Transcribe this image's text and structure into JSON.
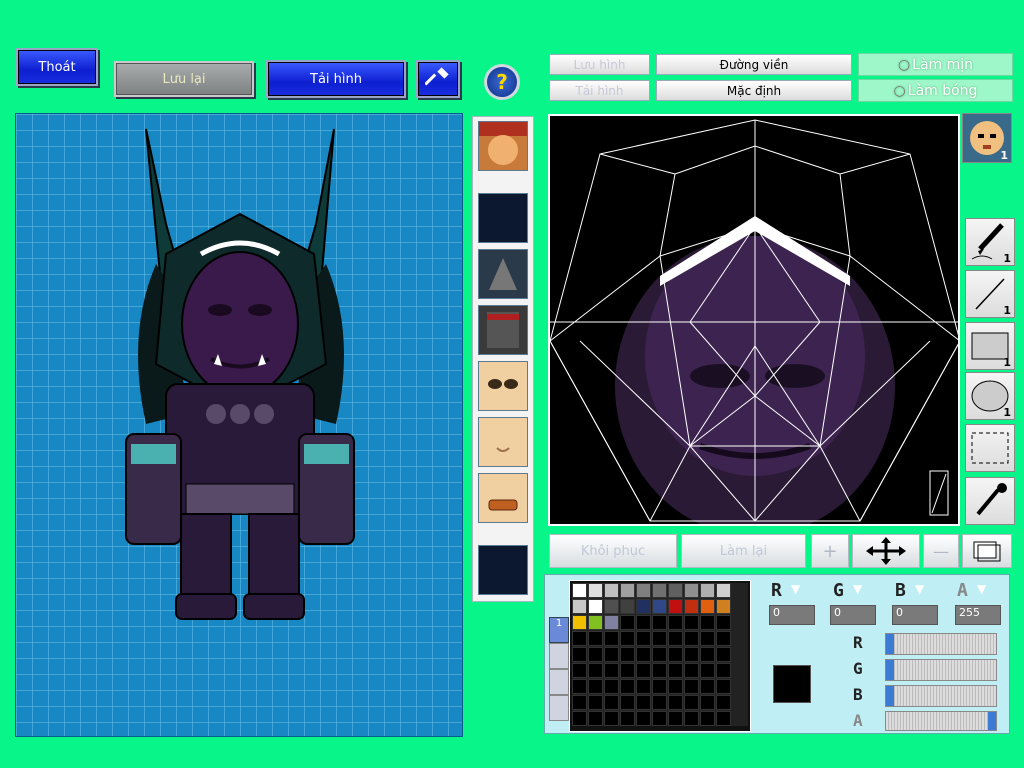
{
  "top_left": {
    "exit_label": "Thoát",
    "save_label": "Lưu lại",
    "reload_label": "Tải hình"
  },
  "top_right": {
    "save_image_label": "Lưu hình",
    "reload_image_label": "Tải hình",
    "outline_label": "Đường viền",
    "default_label": "Mặc định",
    "smooth_label": "Làm mịn",
    "shade_label": "Làm bóng"
  },
  "tools": {
    "pen_count": "1",
    "line_count": "1",
    "rect_count": "1",
    "ellipse_count": "1",
    "avatar_count": "1"
  },
  "bottom_actions": {
    "restore_label": "Khôi phục",
    "redo_label": "Làm lại"
  },
  "color": {
    "r_value": "0",
    "g_value": "0",
    "b_value": "0",
    "a_value": "255",
    "current_hex": "#000000",
    "slider_r": 0,
    "slider_g": 0,
    "slider_b": 0,
    "slider_a": 1,
    "palette_row1": [
      "#ffffff",
      "#e0e0e0",
      "#c0c0c0",
      "#a0a0a0",
      "#808080",
      "#707070",
      "#606060",
      "#909090",
      "#b0b0b0",
      "#d0d0d0"
    ],
    "palette_row2": [
      "#c8c8c8",
      "#ffffff",
      "#505050",
      "#404040",
      "#203060",
      "#304888",
      "#c01010",
      "#c03010",
      "#e06010",
      "#d08020"
    ],
    "palette_row3": [
      "#f0c000",
      "#80c020",
      "#8080a0"
    ]
  },
  "left_tabs": [
    "1"
  ],
  "icons": [
    "help-icon",
    "hammer-icon",
    "move-icon",
    "eyedropper-icon",
    "pen-icon"
  ]
}
